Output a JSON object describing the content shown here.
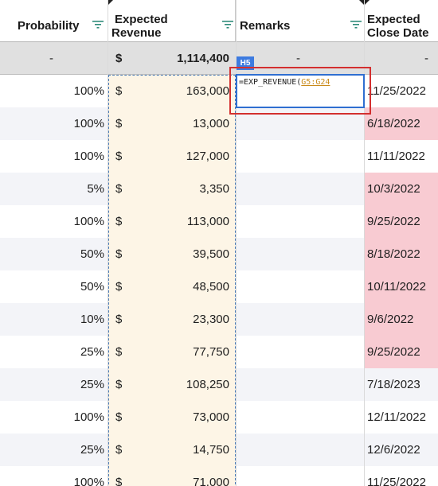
{
  "headers": {
    "probability": "Probability",
    "expected_revenue_1": "Expected",
    "expected_revenue_2": "Revenue",
    "remarks": "Remarks",
    "close_1": "Expected",
    "close_2": "Close Date"
  },
  "summary": {
    "probability": "-",
    "currency": "$",
    "revenue": "1,114,400",
    "remarks": "-",
    "close": "-"
  },
  "cell_ref": "H5",
  "formula": {
    "prefix": "=EXP_REVENUE(",
    "range": "G5:G24"
  },
  "rows": [
    {
      "prob": "100%",
      "cur": "$",
      "rev": "163,000",
      "date": "11/25/2022",
      "overdue": false
    },
    {
      "prob": "100%",
      "cur": "$",
      "rev": "13,000",
      "date": "6/18/2022",
      "overdue": true
    },
    {
      "prob": "100%",
      "cur": "$",
      "rev": "127,000",
      "date": "11/11/2022",
      "overdue": false
    },
    {
      "prob": "5%",
      "cur": "$",
      "rev": "3,350",
      "date": "10/3/2022",
      "overdue": true
    },
    {
      "prob": "100%",
      "cur": "$",
      "rev": "113,000",
      "date": "9/25/2022",
      "overdue": true
    },
    {
      "prob": "50%",
      "cur": "$",
      "rev": "39,500",
      "date": "8/18/2022",
      "overdue": true
    },
    {
      "prob": "50%",
      "cur": "$",
      "rev": "48,500",
      "date": "10/11/2022",
      "overdue": true
    },
    {
      "prob": "10%",
      "cur": "$",
      "rev": "23,300",
      "date": "9/6/2022",
      "overdue": true
    },
    {
      "prob": "25%",
      "cur": "$",
      "rev": "77,750",
      "date": "9/25/2022",
      "overdue": true
    },
    {
      "prob": "25%",
      "cur": "$",
      "rev": "108,250",
      "date": "7/18/2023",
      "overdue": false
    },
    {
      "prob": "100%",
      "cur": "$",
      "rev": "73,000",
      "date": "12/11/2022",
      "overdue": false
    },
    {
      "prob": "25%",
      "cur": "$",
      "rev": "14,750",
      "date": "12/6/2022",
      "overdue": false
    },
    {
      "prob": "100%",
      "cur": "$",
      "rev": "71,000",
      "date": "11/25/2022",
      "overdue": false
    }
  ],
  "colors": {
    "overdue_bg": "#f8cbd2",
    "band_bg": "#f3f4f8",
    "revenue_col_bg": "#fdf5e6",
    "filter_icon": "#2e8b7a",
    "selection": "#2f6fd1",
    "highlight_box": "#d32f2f"
  }
}
